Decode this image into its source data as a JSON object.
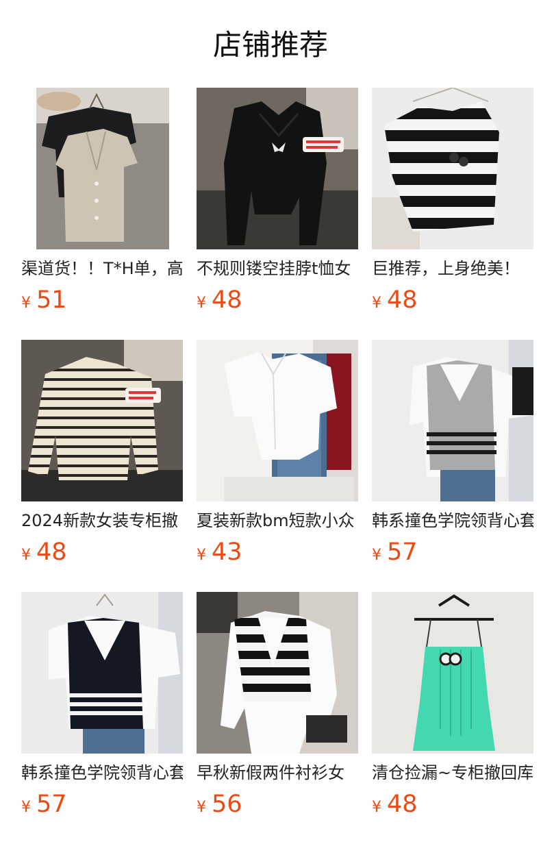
{
  "page": {
    "title": "店铺推荐"
  },
  "currency_symbol": "¥",
  "colors": {
    "price": "#ec4a12",
    "title": "#111111"
  },
  "products": [
    {
      "name": "渠道货！！T*H单，高",
      "price": "51",
      "image": "linen-vest-black-tee"
    },
    {
      "name": "不规则镂空挂脖t恤女",
      "price": "48",
      "image": "black-cutout-halter-top"
    },
    {
      "name": "巨推荐，上身绝美！",
      "price": "48",
      "image": "black-white-stripe-knit"
    },
    {
      "name": "2024新款女装专柜撤",
      "price": "48",
      "image": "beige-stripe-long-sleeve"
    },
    {
      "name": "夏装新款bm短款小众",
      "price": "43",
      "image": "white-polo-with-jeans"
    },
    {
      "name": "韩系撞色学院领背心套",
      "price": "57",
      "image": "grey-knit-vest-set"
    },
    {
      "name": "韩系撞色学院领背心套",
      "price": "57",
      "image": "navy-knit-vest-set"
    },
    {
      "name": "早秋新假两件衬衫女",
      "price": "56",
      "image": "stripe-vest-white-shirt"
    },
    {
      "name": "清仓捡漏~专柜撤回库",
      "price": "48",
      "image": "mint-camisole-dress"
    }
  ]
}
